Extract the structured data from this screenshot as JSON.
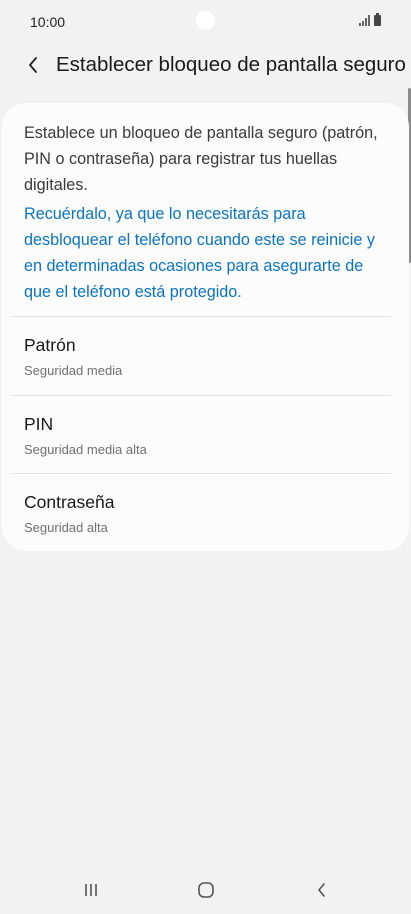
{
  "status_bar": {
    "time": "10:00"
  },
  "header": {
    "title": "Establecer bloqueo de pantalla seguro",
    "back_icon": "chevron-left-icon"
  },
  "card": {
    "description": "Establece un bloqueo de pantalla seguro (patrón, PIN o contraseña) para registrar tus huellas digitales.",
    "note": "Recuérdalo, ya que lo necesitarás para desbloquear el teléfono cuando este se reinicie y en determinadas ocasiones para asegurarte de que el teléfono está protegido.",
    "options": [
      {
        "title": "Patrón",
        "subtitle": "Seguridad media"
      },
      {
        "title": "PIN",
        "subtitle": "Seguridad media alta"
      },
      {
        "title": "Contraseña",
        "subtitle": "Seguridad alta"
      }
    ]
  },
  "nav_bar": {
    "recents_icon": "recents-icon",
    "home_icon": "home-icon",
    "back_icon": "back-icon"
  },
  "colors": {
    "background": "#f2f2f2",
    "card": "#fcfcfc",
    "accent_text": "#0a74c4",
    "secondary_text": "#707070"
  }
}
